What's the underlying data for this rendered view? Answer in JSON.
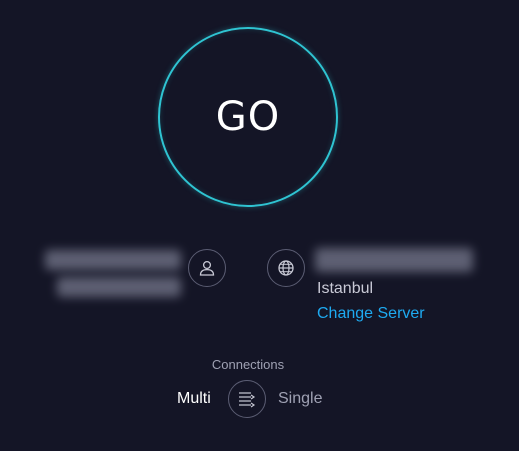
{
  "go_button": {
    "label": "GO"
  },
  "isp": {
    "name": "",
    "ip": ""
  },
  "server": {
    "name": "",
    "city": "Istanbul",
    "change_label": "Change Server"
  },
  "connections": {
    "label": "Connections",
    "multi_label": "Multi",
    "single_label": "Single",
    "selected": "Multi"
  },
  "icons": {
    "user": "user-icon",
    "globe": "globe-icon",
    "connections": "connections-icon"
  },
  "colors": {
    "background": "#141526",
    "ring": "#2fc4d2",
    "link": "#1eaaf1",
    "muted": "#9fa1b3"
  }
}
